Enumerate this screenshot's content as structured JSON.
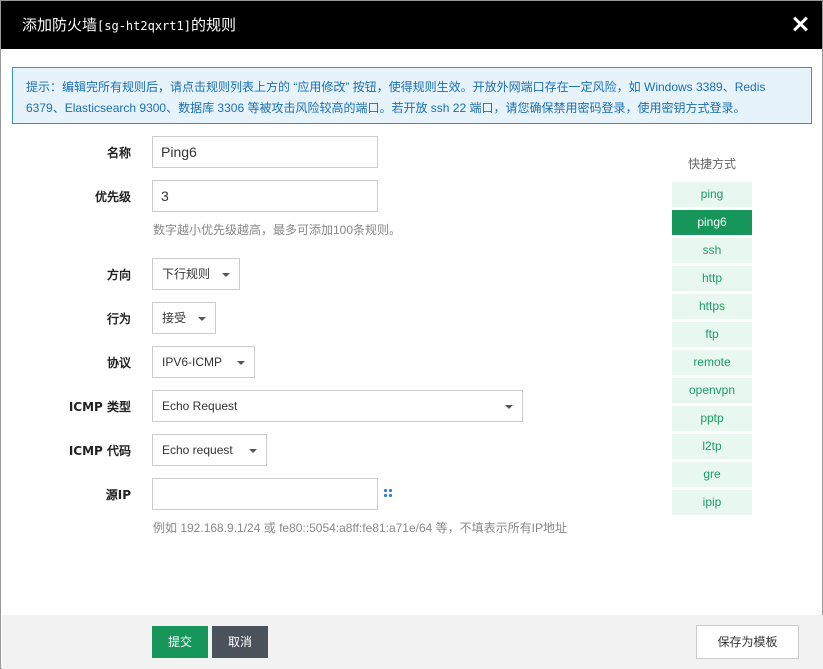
{
  "dialog": {
    "title_prefix": "添加防火墙",
    "title_mono": "[sg-ht2qxrt1]",
    "title_suffix": "的规则"
  },
  "notice": {
    "line1": "提示：编辑完所有规则后，请点击规则列表上方的 “应用修改” 按钮，使得规则生效。开放外网端口存在一定风险，如 Windows 3389、Redis",
    "line2": "6379、Elasticsearch 9300、数据库 3306 等被攻击风险较高的端口。若开放 ssh 22 端口，请您确保禁用密码登录，使用密钥方式登录。"
  },
  "form": {
    "name": {
      "label": "名称",
      "value": "Ping6"
    },
    "priority": {
      "label": "优先级",
      "value": "3",
      "hint": "数字越小优先级越高，最多可添加100条规则。"
    },
    "direction": {
      "label": "方向",
      "value": "下行规则"
    },
    "action": {
      "label": "行为",
      "value": "接受"
    },
    "protocol": {
      "label": "协议",
      "value": "IPV6-ICMP"
    },
    "icmp_type": {
      "label": "ICMP 类型",
      "value": "Echo Request"
    },
    "icmp_code": {
      "label": "ICMP 代码",
      "value": "Echo request"
    },
    "source_ip": {
      "label": "源IP",
      "value": "",
      "hint": "例如 192.168.9.1/24 或 fe80::5054:a8ff:fe81:a71e/64 等，不填表示所有IP地址"
    }
  },
  "shortcuts": {
    "title": "快捷方式",
    "items": [
      "ping",
      "ping6",
      "ssh",
      "http",
      "https",
      "ftp",
      "remote",
      "openvpn",
      "pptp",
      "l2tp",
      "gre",
      "ipip"
    ],
    "active": "ping6"
  },
  "footer": {
    "submit": "提交",
    "cancel": "取消",
    "save_template": "保存为模板"
  },
  "colors": {
    "header_bg": "#000000",
    "accent_green": "#16965a",
    "notice_blue": "#1a6fb5",
    "cancel_gray": "#4a535b"
  }
}
